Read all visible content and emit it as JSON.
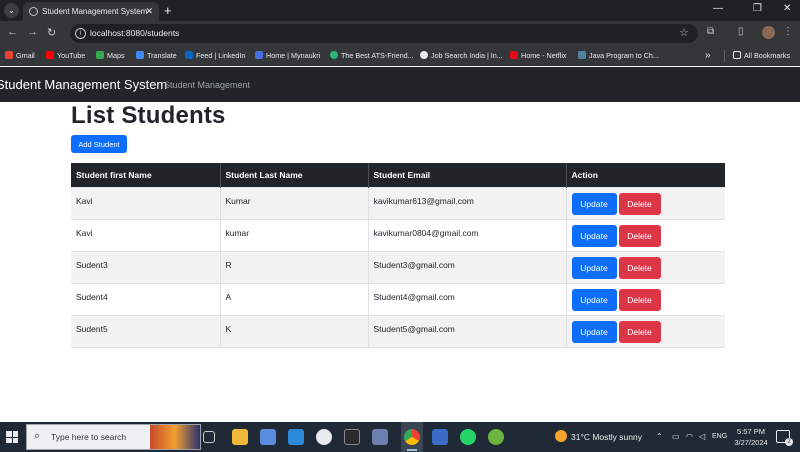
{
  "browser": {
    "tab_title": "Student Management System",
    "tab_close": "✕",
    "new_tab": "+",
    "url": "localhost:8080/students",
    "bookmarks": [
      "Gmail",
      "YouTube",
      "Maps",
      "Translate",
      "Feed | LinkedIn",
      "Home | Mynaukri",
      "The Best ATS-Friend...",
      "Job Search India | In...",
      "Home - Netflix",
      "Java Program to Ch..."
    ],
    "bookmarks_overflow": "»",
    "all_bookmarks": "All Bookmarks"
  },
  "app": {
    "brand": "Student Management System",
    "nav_link": "Student Management",
    "page_title": "List Students",
    "add_button": "Add Student",
    "table": {
      "headers": [
        "Student first Name",
        "Student Last Name",
        "Student Email",
        "Action"
      ],
      "rows": [
        {
          "first": "Kavi",
          "last": "Kumar",
          "email": "kavikumar613@gmail.com"
        },
        {
          "first": "Kavi",
          "last": "kumar",
          "email": "kavikumar0804@gmail.com"
        },
        {
          "first": "Sudent3",
          "last": "R",
          "email": "Student3@gmail.com"
        },
        {
          "first": "Sudent4",
          "last": "A",
          "email": "Student4@gmail.com"
        },
        {
          "first": "Sudent5",
          "last": "K",
          "email": "Student5@gmail.com"
        }
      ],
      "update_label": "Update",
      "delete_label": "Delete"
    }
  },
  "taskbar": {
    "search_placeholder": "Type here to search",
    "weather": "31°C  Mostly sunny",
    "language": "ENG",
    "time": "5:57 PM",
    "date": "3/27/2024",
    "notification_count": "2"
  },
  "colors": {
    "primary": "#0d6efd",
    "danger": "#dc3545",
    "navbar": "#212529"
  }
}
